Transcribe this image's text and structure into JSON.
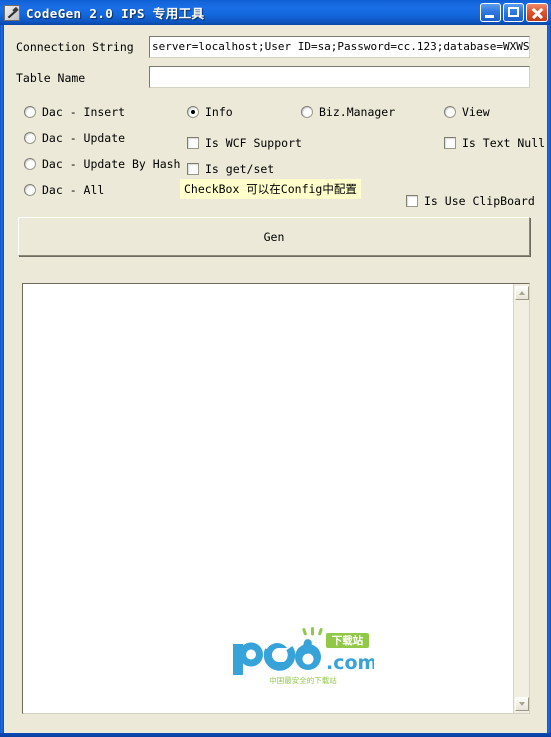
{
  "window": {
    "title": "CodeGen 2.0 IPS 专用工具",
    "icon": "tool-icon",
    "buttons": {
      "minimize": "minimize-button",
      "maximize": "maximize-button",
      "close": "close-button"
    },
    "accent_color": "#1569e0",
    "client_bg": "#ece9d8"
  },
  "form": {
    "fields": [
      {
        "label": "Connection String",
        "value": "server=localhost;User ID=sa;Password=cc.123;database=WXWS",
        "placeholder": ""
      },
      {
        "label": "Table Name",
        "value": "",
        "placeholder": ""
      }
    ],
    "radios": [
      {
        "label": "Dac - Insert",
        "checked": false
      },
      {
        "label": "Dac - Update",
        "checked": false
      },
      {
        "label": "Dac - Update By Hash",
        "checked": false
      },
      {
        "label": "Dac - All",
        "checked": false
      },
      {
        "label": "Info",
        "checked": true
      },
      {
        "label": "Biz.Manager",
        "checked": false
      },
      {
        "label": "View",
        "checked": false
      }
    ],
    "checkboxes": [
      {
        "label": "Is WCF Support",
        "checked": false
      },
      {
        "label": "Is get/set",
        "checked": false
      },
      {
        "label": "Is Text Null",
        "checked": false
      },
      {
        "label": "Is Use ClipBoard",
        "checked": false
      }
    ],
    "hint": {
      "text": "CheckBox 可以在Config中配置",
      "background": "#ffffcc"
    },
    "generate_button": "Gen"
  },
  "output": {
    "content": "",
    "watermark": {
      "brand": "pc6",
      "domain": ".com",
      "badge": "下载站",
      "tagline": "中国最安全的下载站",
      "blue": "#2e9fd8",
      "green": "#8cc63f",
      "gray": "#9aa0a6"
    },
    "scrollbar": {
      "up": "scroll-up-arrow",
      "down": "scroll-down-arrow"
    }
  }
}
